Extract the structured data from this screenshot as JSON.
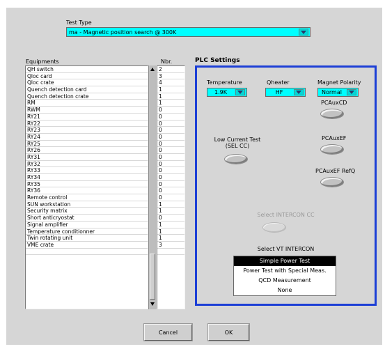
{
  "test_type": {
    "label": "Test Type",
    "value": "ma - Magnetic position search @ 300K"
  },
  "equipments": {
    "col_name": "Equipments",
    "col_nbr": "Nbr.",
    "rows": [
      {
        "name": "QH switch",
        "nbr": "2"
      },
      {
        "name": "Qloc card",
        "nbr": "3"
      },
      {
        "name": "Qloc crate",
        "nbr": "4"
      },
      {
        "name": "Quench detection card",
        "nbr": "1"
      },
      {
        "name": "Quench detection crate",
        "nbr": "1"
      },
      {
        "name": "RM",
        "nbr": "1"
      },
      {
        "name": "RWM",
        "nbr": "0"
      },
      {
        "name": "RY21",
        "nbr": "0"
      },
      {
        "name": "RY22",
        "nbr": "0"
      },
      {
        "name": "RY23",
        "nbr": "0"
      },
      {
        "name": "RY24",
        "nbr": "0"
      },
      {
        "name": "RY25",
        "nbr": "0"
      },
      {
        "name": "RY26",
        "nbr": "0"
      },
      {
        "name": "RY31",
        "nbr": "0"
      },
      {
        "name": "RY32",
        "nbr": "0"
      },
      {
        "name": "RY33",
        "nbr": "0"
      },
      {
        "name": "RY34",
        "nbr": "0"
      },
      {
        "name": "RY35",
        "nbr": "0"
      },
      {
        "name": "RY36",
        "nbr": "0"
      },
      {
        "name": "Remote control",
        "nbr": "0"
      },
      {
        "name": "SUN workstation",
        "nbr": "1"
      },
      {
        "name": "Security matrix",
        "nbr": "1"
      },
      {
        "name": "Short anticryostat",
        "nbr": "0"
      },
      {
        "name": "Signal amplifier",
        "nbr": "1"
      },
      {
        "name": "Temperature conditionner",
        "nbr": "1"
      },
      {
        "name": "Twin rotating unit",
        "nbr": "1"
      },
      {
        "name": "VME crate",
        "nbr": "3"
      },
      {
        "name": "",
        "nbr": ""
      }
    ]
  },
  "plc": {
    "title": "PLC Settings",
    "temperature": {
      "label": "Temperature",
      "value": "1.9K"
    },
    "qheater": {
      "label": "Qheater",
      "value": "HF"
    },
    "magnet_polarity": {
      "label": "Magnet Polarity",
      "value": "Normal"
    },
    "pcauxcd": "PCAuxCD",
    "pcauxef": "PCAuxEF",
    "pcauxef_refq": "PCAuxEF RefQ",
    "low_current_line1": "Low Current Test",
    "low_current_line2": "(SEL CC)",
    "select_intercon_cc": "Select INTERCON CC",
    "select_vt_intercon": "Select VT INTERCON",
    "vt_options": [
      "Simple Power Test",
      "Power Test with Special Meas.",
      "QCD Measurement",
      "None"
    ],
    "vt_selected": "Simple Power Test"
  },
  "buttons": {
    "cancel": "Cancel",
    "ok": "OK"
  },
  "colors": {
    "accent_border": "#1c3fd6",
    "combo_bg": "#00ffff",
    "window_bg": "#d6d6d6"
  }
}
